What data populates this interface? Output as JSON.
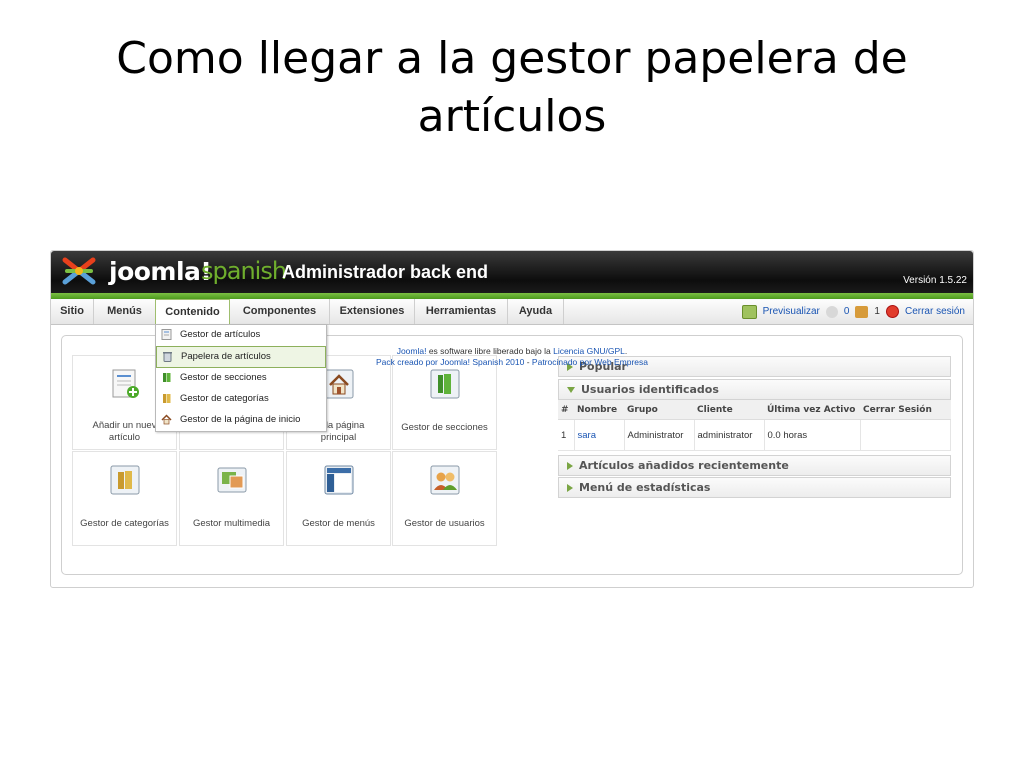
{
  "slide": {
    "title_line1": "Como llegar a la gestor papelera de",
    "title_line2": "artículos"
  },
  "header": {
    "brand": "joomla!",
    "brand_sub": "spanish",
    "admin_title": "Administrador back end",
    "version": "Versión 1.5.22"
  },
  "menu": {
    "items": [
      "Sitio",
      "Menús",
      "Contenido",
      "Componentes",
      "Extensiones",
      "Herramientas",
      "Ayuda"
    ],
    "active": "Contenido",
    "preview": "Previsualizar",
    "messages_count": "0",
    "users_count": "1",
    "logout": "Cerrar sesión"
  },
  "dropdown": {
    "items": [
      "Gestor de artículos",
      "Papelera de artículos",
      "Gestor de secciones",
      "Gestor de categorías",
      "Gestor de la página de inicio"
    ],
    "highlighted": "Papelera de artículos"
  },
  "cpanel": {
    "icons": [
      {
        "label": "Añadir un nuevo artículo",
        "icon": "add-article-icon"
      },
      {
        "label": "",
        "icon": "hidden"
      },
      {
        "label": "Gestor de la página principal",
        "icon": "home-icon"
      },
      {
        "label": "Gestor de secciones",
        "icon": "sections-icon"
      },
      {
        "label": "Gestor de categorías",
        "icon": "categories-icon"
      },
      {
        "label": "Gestor multimedia",
        "icon": "media-icon"
      },
      {
        "label": "Gestor de menús",
        "icon": "menus-icon"
      },
      {
        "label": "Gestor de usuarios",
        "icon": "users-icon"
      }
    ],
    "label_add_visible": "Añadir un nuev",
    "label_add_line2": "artículo",
    "label_home_visible": "de la página",
    "label_home_line2": "principal"
  },
  "modules": {
    "popular": "Popular",
    "logged_in": "Usuarios identificados",
    "recent": "Artículos añadidos recientemente",
    "stats": "Menú de estadísticas",
    "table": {
      "headers": [
        "#",
        "Nombre",
        "Grupo",
        "Cliente",
        "Última vez Activo",
        "Cerrar Sesión"
      ],
      "rows": [
        [
          "1",
          "sara",
          "Administrator",
          "administrator",
          "0.0 horas",
          ""
        ]
      ]
    }
  },
  "footer": {
    "line1_a": "Joomla!",
    "line1_b": " es software libre liberado bajo la ",
    "line1_c": "Licencia GNU/GPL",
    "line1_d": ".",
    "line2_a": "Pack creado por Joomla! Spanish 2010",
    "line2_b": " - ",
    "line2_c": "Patrocinado por Web Empresa"
  },
  "colors": {
    "accent_green": "#6fae2d",
    "link_blue": "#1a55b3",
    "header_dark": "#111111"
  }
}
